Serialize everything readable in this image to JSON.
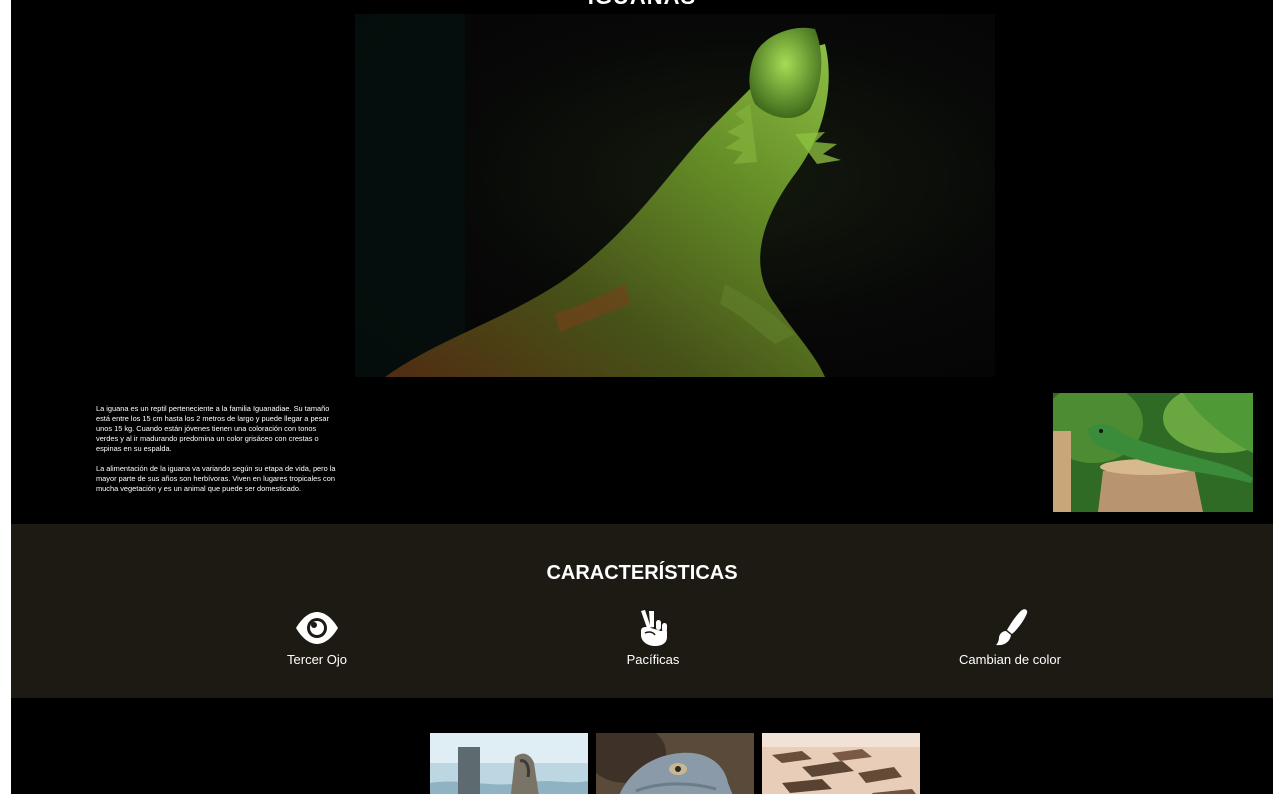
{
  "hero": {
    "title": "IGUANAS",
    "image_icon": "bearded-dragon-photo"
  },
  "intro": {
    "paragraphs": [
      "La iguana es un reptil perteneciente a la familia Iguanadiae. Su tamaño está entre los 15 cm hasta los 2 metros de largo y puede llegar a pesar unos 15 kg. Cuando están jóvenes tienen una coloración con tonos verdes y al ir madurando predomina un color grisáceo con crestas o espinas en su espalda.",
      "La alimentación de la iguana va variando según su etapa de vida, pero la mayor parte de sus años son herbívoras. Viven en lugares tropicales con mucha vegetación y es un animal que puede ser domesticado."
    ],
    "side_image_icon": "green-iguana-photo"
  },
  "features": {
    "title": "CARACTERÍSTICAS",
    "items": [
      {
        "icon": "eye-icon",
        "label": "Tercer Ojo"
      },
      {
        "icon": "peace-hand-icon",
        "label": "Pacíficas"
      },
      {
        "icon": "paint-brush-icon",
        "label": "Cambian de color"
      }
    ]
  },
  "gallery": {
    "thumbnails": [
      {
        "icon": "iguana-on-rock-photo"
      },
      {
        "icon": "iguana-head-photo"
      },
      {
        "icon": "iguanas-on-sand-photo"
      }
    ]
  },
  "colors": {
    "page_background": "#000000",
    "features_background": "#1d1a14",
    "text": "#ffffff"
  }
}
